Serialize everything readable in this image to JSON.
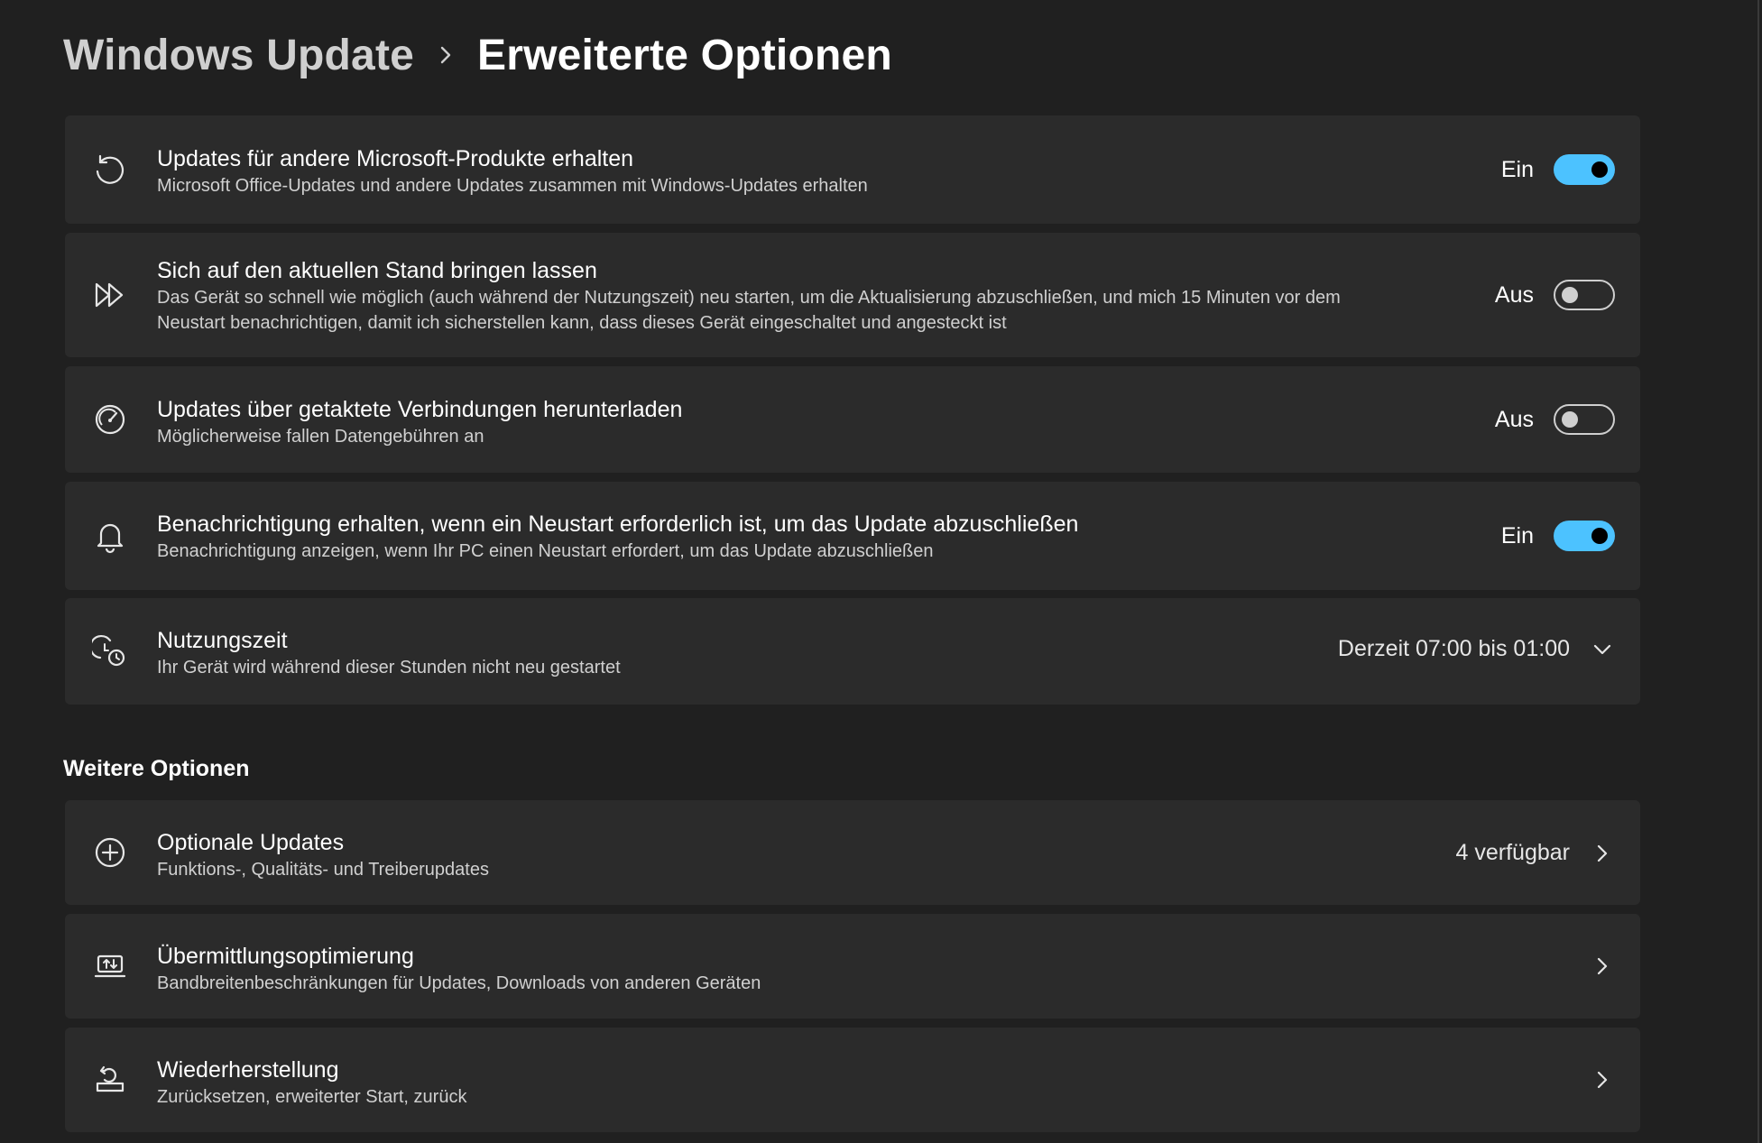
{
  "breadcrumb": {
    "parent": "Windows Update",
    "separator_icon": "chevron-right-icon",
    "current": "Erweiterte Optionen"
  },
  "settings": [
    {
      "icon": "sync-arrow-icon",
      "title": "Updates für andere Microsoft-Produkte erhalten",
      "description": "Microsoft Office-Updates und andere Updates zusammen mit Windows-Updates erhalten",
      "state_label": "Ein",
      "toggle_on": true
    },
    {
      "icon": "fast-forward-icon",
      "title": "Sich auf den aktuellen Stand bringen lassen",
      "description": "Das Gerät so schnell wie möglich (auch während der Nutzungszeit) neu starten, um die Aktualisierung abzuschließen, und mich 15 Minuten vor dem Neustart benachrichtigen, damit ich sicherstellen kann, dass dieses Gerät eingeschaltet und angesteckt ist",
      "state_label": "Aus",
      "toggle_on": false
    },
    {
      "icon": "speedometer-icon",
      "title": "Updates über getaktete Verbindungen herunterladen",
      "description": "Möglicherweise fallen Datengebühren an",
      "state_label": "Aus",
      "toggle_on": false
    },
    {
      "icon": "bell-icon",
      "title": "Benachrichtigung erhalten, wenn ein Neustart erforderlich ist, um das Update abzuschließen",
      "description": "Benachrichtigung anzeigen, wenn Ihr PC einen Neustart erfordert, um das Update abzuschließen",
      "state_label": "Ein",
      "toggle_on": true
    },
    {
      "icon": "active-hours-clock-icon",
      "title": "Nutzungszeit",
      "description": "Ihr Gerät wird während dieser Stunden nicht neu gestartet",
      "value": "Derzeit 07:00 bis 01:00",
      "trailing_icon": "chevron-down-icon"
    }
  ],
  "more_options": {
    "heading": "Weitere Optionen",
    "items": [
      {
        "icon": "plus-circle-icon",
        "title": "Optionale Updates",
        "description": "Funktions-, Qualitäts- und Treiberupdates",
        "value": "4 verfügbar",
        "trailing_icon": "chevron-right-icon"
      },
      {
        "icon": "delivery-optimization-icon",
        "title": "Übermittlungsoptimierung",
        "description": "Bandbreitenbeschränkungen für Updates, Downloads von anderen Geräten",
        "value": "",
        "trailing_icon": "chevron-right-icon"
      },
      {
        "icon": "recovery-icon",
        "title": "Wiederherstellung",
        "description": "Zurücksetzen, erweiterter Start, zurück",
        "value": "",
        "trailing_icon": "chevron-right-icon"
      }
    ]
  },
  "colors": {
    "background": "#202020",
    "card": "#2b2b2b",
    "accent": "#4cc2ff",
    "text_primary": "#ffffff",
    "text_secondary": "#d0d0d0"
  }
}
